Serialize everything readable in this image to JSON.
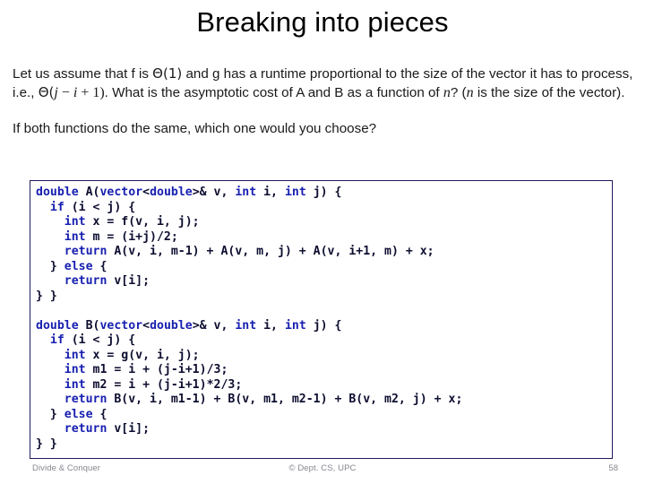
{
  "slide": {
    "title": "Breaking into pieces",
    "page_number": "58"
  },
  "body": {
    "paragraph1": {
      "seg1": "Let us assume that f is ",
      "theta1": "Θ(1)",
      "seg2": " and g has a runtime proportional to the size of the vector it has to process, i.e., ",
      "theta2": "Θ(",
      "math_j": "j",
      "math_minus": " − ",
      "math_i": "i",
      "math_plus": " + ",
      "math_one": "1)",
      "seg3": ".  What is the asymptotic cost of A and B as a function of ",
      "math_n1": "n",
      "seg4": "? (",
      "math_n2": "n",
      "seg5": " is the size of the vector)."
    },
    "paragraph2": "If both functions do the same, which one would you choose?"
  },
  "code": {
    "block_a": [
      [
        {
          "t": "double ",
          "c": "kw"
        },
        {
          "t": "A(",
          "c": "pl"
        },
        {
          "t": "vector",
          "c": "kw"
        },
        {
          "t": "<",
          "c": "pl"
        },
        {
          "t": "double",
          "c": "kw"
        },
        {
          "t": ">& v, ",
          "c": "pl"
        },
        {
          "t": "int",
          "c": "kw"
        },
        {
          "t": " i, ",
          "c": "pl"
        },
        {
          "t": "int",
          "c": "kw"
        },
        {
          "t": " j) {",
          "c": "pl"
        }
      ],
      [
        {
          "t": "  ",
          "c": "pl"
        },
        {
          "t": "if",
          "c": "kw"
        },
        {
          "t": " (i < j) {",
          "c": "pl"
        }
      ],
      [
        {
          "t": "    ",
          "c": "pl"
        },
        {
          "t": "int",
          "c": "kw"
        },
        {
          "t": " x = f(v, i, j);",
          "c": "pl"
        }
      ],
      [
        {
          "t": "    ",
          "c": "pl"
        },
        {
          "t": "int",
          "c": "kw"
        },
        {
          "t": " m = (i+j)/2;",
          "c": "pl"
        }
      ],
      [
        {
          "t": "    ",
          "c": "pl"
        },
        {
          "t": "return",
          "c": "kw"
        },
        {
          "t": " A(v, i, m-1) + A(v, m, j) + A(v, i+1, m) + x;",
          "c": "pl"
        }
      ],
      [
        {
          "t": "  } ",
          "c": "pl"
        },
        {
          "t": "else",
          "c": "kw"
        },
        {
          "t": " {",
          "c": "pl"
        }
      ],
      [
        {
          "t": "    ",
          "c": "pl"
        },
        {
          "t": "return",
          "c": "kw"
        },
        {
          "t": " v[i];",
          "c": "pl"
        }
      ],
      [
        {
          "t": "} }",
          "c": "pl"
        }
      ]
    ],
    "block_b": [
      [
        {
          "t": "double ",
          "c": "kw"
        },
        {
          "t": "B(",
          "c": "pl"
        },
        {
          "t": "vector",
          "c": "kw"
        },
        {
          "t": "<",
          "c": "pl"
        },
        {
          "t": "double",
          "c": "kw"
        },
        {
          "t": ">& v, ",
          "c": "pl"
        },
        {
          "t": "int",
          "c": "kw"
        },
        {
          "t": " i, ",
          "c": "pl"
        },
        {
          "t": "int",
          "c": "kw"
        },
        {
          "t": " j) {",
          "c": "pl"
        }
      ],
      [
        {
          "t": "  ",
          "c": "pl"
        },
        {
          "t": "if",
          "c": "kw"
        },
        {
          "t": " (i < j) {",
          "c": "pl"
        }
      ],
      [
        {
          "t": "    ",
          "c": "pl"
        },
        {
          "t": "int",
          "c": "kw"
        },
        {
          "t": " x = g(v, i, j);",
          "c": "pl"
        }
      ],
      [
        {
          "t": "    ",
          "c": "pl"
        },
        {
          "t": "int",
          "c": "kw"
        },
        {
          "t": " m1 = i + (j-i+1)/3;",
          "c": "pl"
        }
      ],
      [
        {
          "t": "    ",
          "c": "pl"
        },
        {
          "t": "int",
          "c": "kw"
        },
        {
          "t": " m2 = i + (j-i+1)*2/3;",
          "c": "pl"
        }
      ],
      [
        {
          "t": "    ",
          "c": "pl"
        },
        {
          "t": "return",
          "c": "kw"
        },
        {
          "t": " B(v, i, m1-1) + B(v, m1, m2-1) + B(v, m2, j) + x;",
          "c": "pl"
        }
      ],
      [
        {
          "t": "  } ",
          "c": "pl"
        },
        {
          "t": "else",
          "c": "kw"
        },
        {
          "t": " {",
          "c": "pl"
        }
      ],
      [
        {
          "t": "    ",
          "c": "pl"
        },
        {
          "t": "return",
          "c": "kw"
        },
        {
          "t": " v[i];",
          "c": "pl"
        }
      ],
      [
        {
          "t": "} }",
          "c": "pl"
        }
      ]
    ]
  },
  "footer": {
    "left": "Divide & Conquer",
    "center": "© Dept. CS, UPC",
    "right": "58"
  },
  "colors": {
    "code_keyword": "#1820b0",
    "code_plain": "#0d0d30",
    "code_border": "#1f1a5e",
    "footer_text": "#86868f",
    "background": "#ffffff"
  }
}
